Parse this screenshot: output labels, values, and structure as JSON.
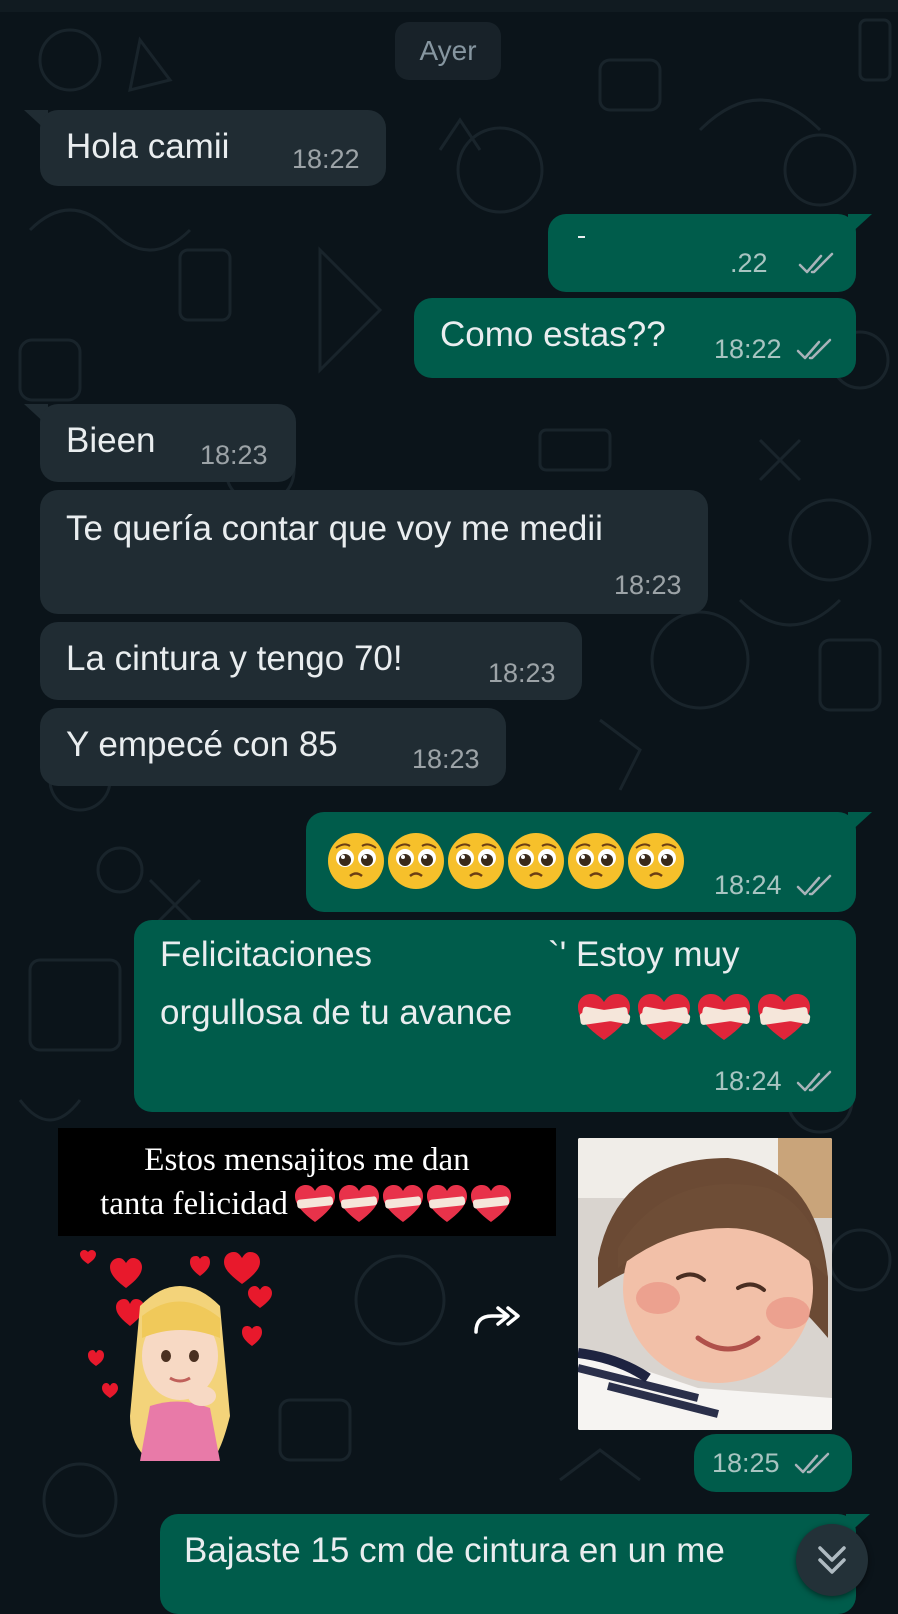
{
  "chat": {
    "date_label": "Ayer",
    "messages": [
      {
        "text": "Hola camii",
        "time": "18:22"
      },
      {
        "text": "",
        "time": ".22"
      },
      {
        "text": "Como estas??",
        "time": "18:22"
      },
      {
        "text": "Bieen",
        "time": "18:23"
      },
      {
        "text": "Te quería contar que voy me medii",
        "time": "18:23"
      },
      {
        "text": "La cintura y tengo 70!",
        "time": "18:23"
      },
      {
        "text": "Y empecé con 85",
        "time": "18:23"
      },
      {
        "text": "",
        "time": "18:24"
      },
      {
        "text_line1": "Felicitaciones",
        "text_line1b": "`' Estoy muy",
        "text_line2": "orgullosa de tu avance",
        "time": "18:24"
      },
      {
        "time": "18:25"
      },
      {
        "text": "Bajaste 15 cm de cintura en un me"
      }
    ],
    "sticker_caption": {
      "line1": "Estos mensajitos me dan",
      "line2": "tanta felicidad"
    }
  },
  "colors": {
    "background": "#0b141a",
    "incoming_bubble": "#202c33",
    "outgoing_bubble": "#005c4b",
    "read_ticks": "#a8b3b9"
  },
  "icons": {
    "read_receipt": "double-check-icon",
    "forward": "forward-icon",
    "scroll_down": "chevron-double-down-icon"
  }
}
